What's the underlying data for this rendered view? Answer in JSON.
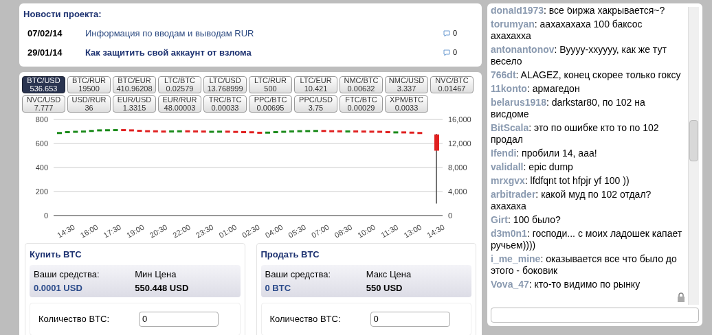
{
  "news": {
    "title": "Новости проекта:",
    "items": [
      {
        "date": "07/02/14",
        "text": "Информация по вводам и выводам RUR",
        "bold": false,
        "comments": "0"
      },
      {
        "date": "29/01/14",
        "text": "Как защитить свой аккаунт от взлома",
        "bold": true,
        "comments": "0"
      }
    ]
  },
  "pairs": [
    {
      "name": "BTC/USD",
      "price": "536.653",
      "selected": true
    },
    {
      "name": "BTC/RUR",
      "price": "19500",
      "selected": false
    },
    {
      "name": "BTC/EUR",
      "price": "410.96208",
      "selected": false
    },
    {
      "name": "LTC/BTC",
      "price": "0.02579",
      "selected": false
    },
    {
      "name": "LTC/USD",
      "price": "13.768999",
      "selected": false
    },
    {
      "name": "LTC/RUR",
      "price": "500",
      "selected": false
    },
    {
      "name": "LTC/EUR",
      "price": "10.421",
      "selected": false
    },
    {
      "name": "NMC/BTC",
      "price": "0.00632",
      "selected": false
    },
    {
      "name": "NMC/USD",
      "price": "3.337",
      "selected": false
    },
    {
      "name": "NVC/BTC",
      "price": "0.01467",
      "selected": false
    },
    {
      "name": "NVC/USD",
      "price": "7.777",
      "selected": false
    },
    {
      "name": "USD/RUR",
      "price": "36",
      "selected": false
    },
    {
      "name": "EUR/USD",
      "price": "1.3315",
      "selected": false
    },
    {
      "name": "EUR/RUR",
      "price": "48.00003",
      "selected": false
    },
    {
      "name": "TRC/BTC",
      "price": "0.00033",
      "selected": false
    },
    {
      "name": "PPC/BTC",
      "price": "0.00695",
      "selected": false
    },
    {
      "name": "PPC/USD",
      "price": "3.75",
      "selected": false
    },
    {
      "name": "FTC/BTC",
      "price": "0.00029",
      "selected": false
    },
    {
      "name": "XPM/BTC",
      "price": "0.0033",
      "selected": false
    }
  ],
  "chart": {
    "x_labels": [
      "14:30",
      "16:00",
      "17:30",
      "19:00",
      "20:30",
      "22:00",
      "23:30",
      "01:00",
      "02:30",
      "04:00",
      "05:30",
      "07:00",
      "08:30",
      "10:00",
      "11:30",
      "13:00",
      "14:30"
    ],
    "left_ticks": [
      "800",
      "600",
      "400",
      "200",
      "0"
    ],
    "right_ticks": [
      "16,000",
      "12,000",
      "8,000",
      "4,000",
      "0"
    ]
  },
  "buy": {
    "title": "Купить BTC",
    "funds_label": "Ваши средства:",
    "funds": "0.0001 USD",
    "price_label": "Мин Цена",
    "price": "550.448 USD",
    "amount_label": "Количество BTC:",
    "amount": "0"
  },
  "sell": {
    "title": "Продать BTC",
    "funds_label": "Ваши средства:",
    "funds": "0 BTC",
    "price_label": "Макс Цена",
    "price": "550 USD",
    "amount_label": "Количество BTC:",
    "amount": "0"
  },
  "chat": {
    "messages": [
      {
        "user": "donald1973",
        "text": ": все биржа хакрывается~?"
      },
      {
        "user": "torumyan",
        "text": ": аахахахаха 100 баксос ахахахха"
      },
      {
        "user": "antonantonov",
        "text": ": Вуууу-ххуууу, как же тут весело"
      },
      {
        "user": "766dt",
        "text": ": ALAGEZ, конец скорее только гоксу"
      },
      {
        "user": "11konto",
        "text": ": армагедон"
      },
      {
        "user": "belarus1918",
        "text": ": darkstar80, по 102 на висдоме"
      },
      {
        "user": "BitScala",
        "text": ": это по ошибке кто то по 102 продал"
      },
      {
        "user": "Ifendi",
        "text": ": пробили 14, ааа!"
      },
      {
        "user": "validall",
        "text": ": epic dump"
      },
      {
        "user": "mrxgvx",
        "text": ": lfdfqnt tot hfpjr yf 100 ))"
      },
      {
        "user": "arbitrader",
        "text": ": какой муд по 102 отдал? ахахаха"
      },
      {
        "user": "Girt",
        "text": ": 100 было?"
      },
      {
        "user": "d3m0n1",
        "text": ": господи... с моих ладошек капает ручьем))))"
      },
      {
        "user": "i_me_mine",
        "text": ": оказывается все что было до этого - боковик"
      },
      {
        "user": "Vova_47",
        "text": ": кто-то видимо по рынку"
      }
    ]
  }
}
